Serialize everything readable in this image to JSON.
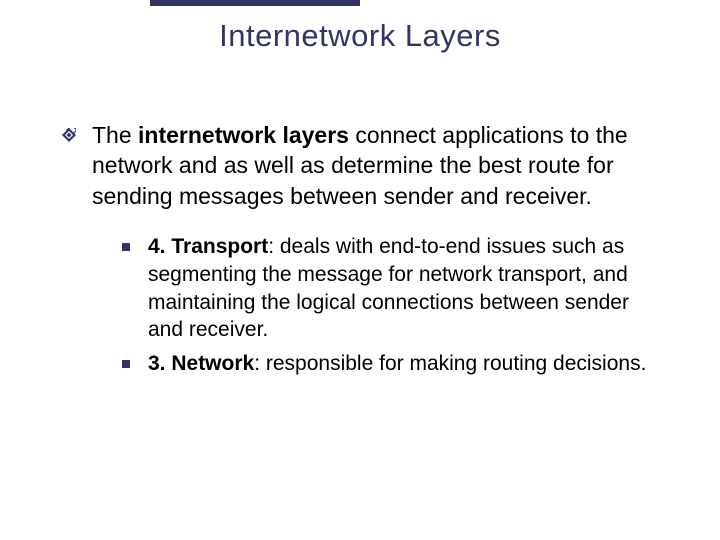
{
  "title": "Internetwork Layers",
  "main": {
    "prefix": "The ",
    "bold": "internetwork layers",
    "suffix": " connect applications to the network and as well as determine the best route for sending messages between sender and receiver."
  },
  "sub_items": [
    {
      "bold": "4. Transport",
      "suffix": ": deals with end-to-end issues such as segmenting the message for network transport, and maintaining the logical connections between sender and receiver."
    },
    {
      "bold": "3. Network",
      "suffix": ": responsible for making routing decisions."
    }
  ]
}
